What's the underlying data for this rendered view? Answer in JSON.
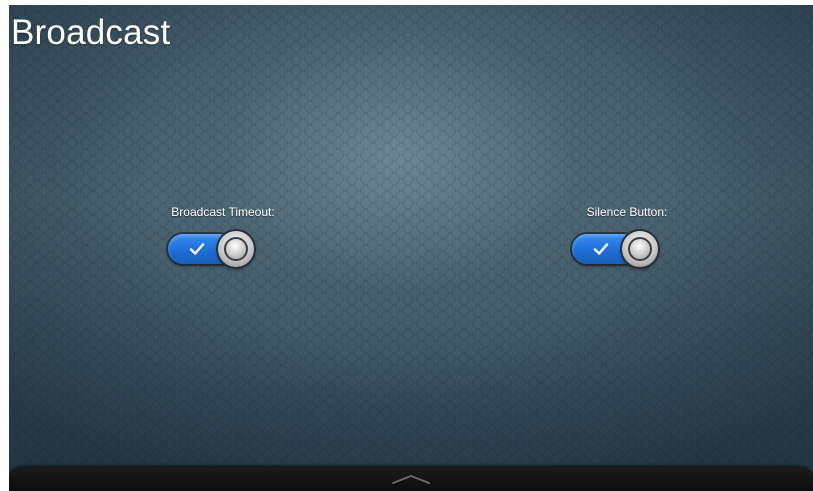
{
  "page": {
    "title": "Broadcast"
  },
  "settings": [
    {
      "label": "Broadcast Timeout:",
      "state": "on",
      "icon": "checkmark-icon"
    },
    {
      "label": "Silence Button:",
      "state": "on",
      "icon": "checkmark-icon"
    }
  ],
  "bottom_bar": {
    "handle_icon": "chevron-up-icon"
  },
  "colors": {
    "toggle_on": "#1d6fd6",
    "background": "#46606e",
    "title_text": "#ffffff",
    "bottom_bar": "#111111"
  }
}
